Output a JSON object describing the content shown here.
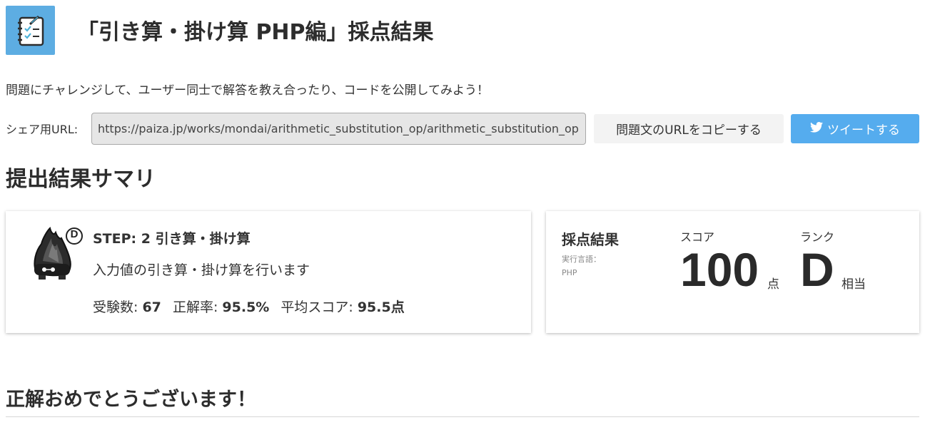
{
  "header": {
    "icon": "notebook-checklist-icon",
    "title": "「引き算・掛け算 PHP編」採点結果"
  },
  "intro_text": "問題にチャレンジして、ユーザー同士で解答を教え合ったり、コードを公開してみよう！",
  "share": {
    "label": "シェア用URL:",
    "url": "https://paiza.jp/works/mondai/arithmetic_substitution_op/arithmetic_substitution_op",
    "copy_button": "問題文のURLをコピーする",
    "tweet_button": "ツイートする",
    "tweet_icon": "twitter-bird-icon",
    "tweet_color": "#55acee"
  },
  "summary_title": "提出結果サマリ",
  "problem": {
    "rank_badge": "D",
    "step_title": "STEP: 2 引き算・掛け算",
    "description": "入力値の引き算・掛け算を行います",
    "examinees_label": "受験数:",
    "examinees_value": "67",
    "accuracy_label": "正解率:",
    "accuracy_value": "95.5%",
    "avg_label": "平均スコア:",
    "avg_value": "95.5点"
  },
  "result": {
    "heading": "採点結果",
    "lang_label": "実行言語：",
    "lang_value": "PHP",
    "score_label": "スコア",
    "score_value": "100",
    "score_unit": "点",
    "rank_label": "ランク",
    "rank_value": "D",
    "rank_unit": "相当"
  },
  "congrats": "正解おめでとうございます！"
}
